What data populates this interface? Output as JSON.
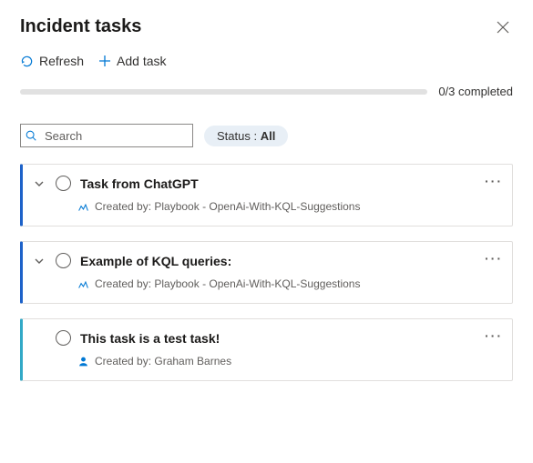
{
  "header": {
    "title": "Incident tasks"
  },
  "toolbar": {
    "refresh_label": "Refresh",
    "addtask_label": "Add task"
  },
  "progress": {
    "text": "0/3 completed"
  },
  "filters": {
    "search_placeholder": "Search",
    "status_label": "Status : ",
    "status_value": "All"
  },
  "tasks": [
    {
      "title": "Task from ChatGPT",
      "created_by": "Created by: Playbook - OpenAi-With-KQL-Suggestions",
      "creator_type": "playbook",
      "expandable": true,
      "accent": "blue"
    },
    {
      "title": "Example of KQL queries:",
      "created_by": "Created by: Playbook - OpenAi-With-KQL-Suggestions",
      "creator_type": "playbook",
      "expandable": true,
      "accent": "blue"
    },
    {
      "title": "This task is a test task!",
      "created_by": "Created by: Graham Barnes",
      "creator_type": "user",
      "expandable": false,
      "accent": "teal"
    }
  ]
}
